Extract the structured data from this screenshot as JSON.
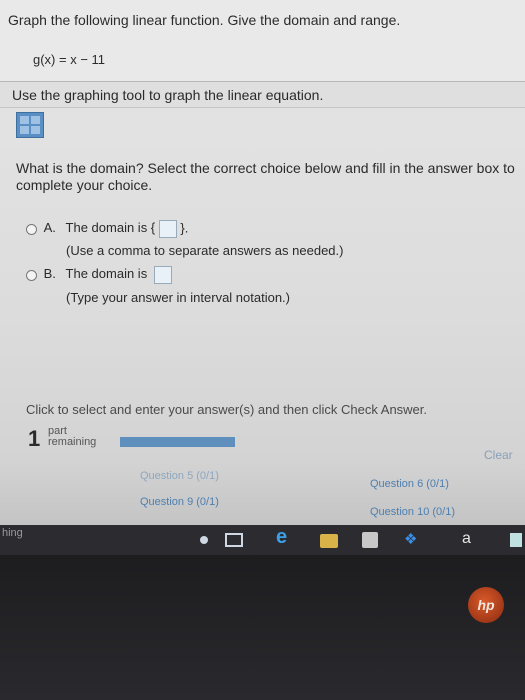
{
  "question": {
    "title": "Graph the following linear function. Give the domain and range.",
    "function": "g(x) = x − 11"
  },
  "instruction": "Use the graphing tool to graph the linear equation.",
  "domain_question": "What is the domain? Select the correct choice below and fill in the answer box to complete your choice.",
  "choices": [
    {
      "letter": "A.",
      "text_before": "The domain is {",
      "text_after": "}.",
      "hint": "(Use a comma to separate answers as needed.)"
    },
    {
      "letter": "B.",
      "text_before": "The domain is",
      "text_after": "",
      "hint": "(Type your answer in interval notation.)"
    }
  ],
  "footer_hint": "Click to select and enter your answer(s) and then click Check Answer.",
  "parts": {
    "count": "1",
    "label_line1": "part",
    "label_line2": "remaining",
    "progress": 1.0
  },
  "clear_label": "Clear",
  "question_nav": [
    "Question 5 (0/1)",
    "Question 9 (0/1)",
    "Question 6 (0/1)",
    "Question 10 (0/1)"
  ],
  "taskbar": {
    "label": "hing",
    "app_a": "a"
  },
  "brand": "hp",
  "icons": [
    "task-view-icon",
    "edge-icon",
    "folder-icon",
    "store-icon",
    "dropbox-icon",
    "app-a-icon",
    "graph-tool-icon"
  ]
}
